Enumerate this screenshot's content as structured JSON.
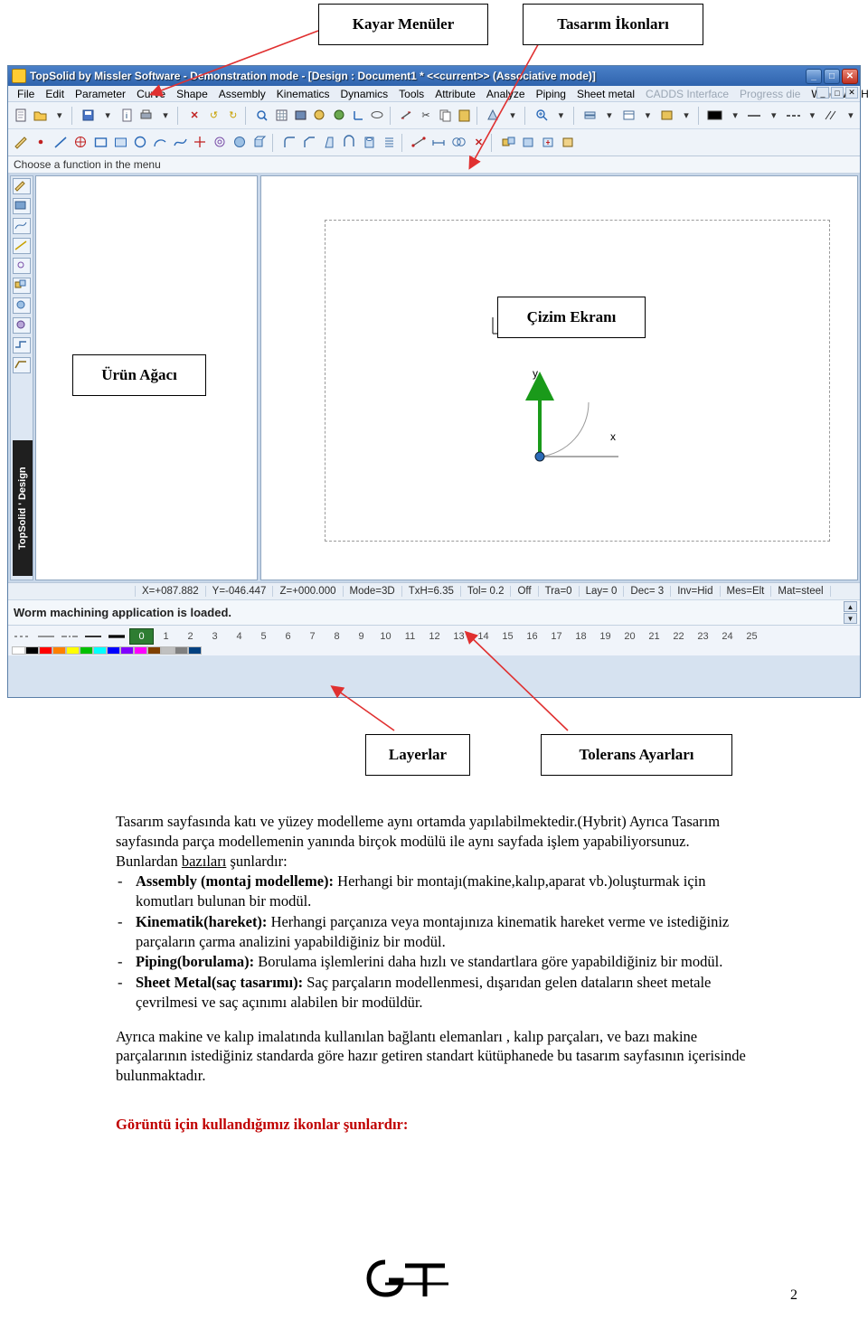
{
  "callouts": [
    {
      "id": "kayar-menuler",
      "label": "Kayar Menüler"
    },
    {
      "id": "tasarim-ikonlari",
      "label": "Tasarım İkonları"
    },
    {
      "id": "cizim-ekrani",
      "label": "Çizim Ekranı"
    },
    {
      "id": "urun-agaci",
      "label": "Ürün Ağacı"
    },
    {
      "id": "layerlar",
      "label": "Layerlar"
    },
    {
      "id": "tolerans-ayarlari",
      "label": "Tolerans  Ayarları"
    }
  ],
  "app": {
    "title": "TopSolid by Missler Software - Demonstration mode  - [Design : Document1 *  <<current>> (Associative mode)]",
    "title_icon": "topsolid-logo-icon",
    "window_buttons": [
      {
        "name": "minimize-button",
        "glyph": "_"
      },
      {
        "name": "maximize-button",
        "glyph": "□"
      },
      {
        "name": "close-button",
        "glyph": "✕"
      }
    ],
    "menu": [
      {
        "label": "File",
        "dim": false
      },
      {
        "label": "Edit",
        "dim": false
      },
      {
        "label": "Parameter",
        "dim": false
      },
      {
        "label": "Curve",
        "dim": false
      },
      {
        "label": "Shape",
        "dim": false
      },
      {
        "label": "Assembly",
        "dim": false
      },
      {
        "label": "Kinematics",
        "dim": false
      },
      {
        "label": "Dynamics",
        "dim": false
      },
      {
        "label": "Tools",
        "dim": false
      },
      {
        "label": "Attribute",
        "dim": false
      },
      {
        "label": "Analyze",
        "dim": false
      },
      {
        "label": "Piping",
        "dim": false
      },
      {
        "label": "Sheet metal",
        "dim": false
      },
      {
        "label": "CADDS Interface",
        "dim": true
      },
      {
        "label": "Progress die",
        "dim": true
      },
      {
        "label": "Window",
        "dim": false
      },
      {
        "label": "Help",
        "dim": false
      }
    ],
    "menu_window_buttons": [
      {
        "name": "mdi-minimize-button",
        "glyph": "_"
      },
      {
        "name": "mdi-restore-button",
        "glyph": "□"
      },
      {
        "name": "mdi-close-button",
        "glyph": "✕"
      }
    ],
    "prompt": "Choose a function in the menu",
    "vertical_label": "TopSolid ' Design",
    "coord_items": [
      "X=+087.882",
      "Y=-046.447",
      "Z=+000.000",
      "Mode=3D",
      "TxH=6.35",
      "Tol= 0.2",
      "Off",
      "Tra=0",
      "Lay= 0",
      "Dec= 3",
      "Inv=Hid",
      "Mes=Elt",
      "Mat=steel"
    ],
    "message": "Worm machining application is loaded.",
    "layers": [
      "0",
      "1",
      "2",
      "3",
      "4",
      "5",
      "6",
      "7",
      "8",
      "9",
      "10",
      "11",
      "12",
      "13",
      "14",
      "15",
      "16",
      "17",
      "18",
      "19",
      "20",
      "21",
      "22",
      "23",
      "24",
      "25"
    ],
    "active_layer": "0",
    "axis_labels": {
      "x": "x",
      "y": "y"
    },
    "palette": [
      "#ffffff",
      "#000000",
      "#ff0000",
      "#ff8000",
      "#ffff00",
      "#00c000",
      "#00ffff",
      "#0000ff",
      "#8000ff",
      "#ff00ff",
      "#804000",
      "#c0c0c0",
      "#808080",
      "#004080"
    ]
  },
  "body": {
    "para1": "Tasarım sayfasında katı ve yüzey modelleme aynı ortamda yapılabilmektedir.(Hybrit) Ayrıca Tasarım sayfasında parça modellemenin yanında birçok modülü ile aynı sayfada işlem yapabiliyorsunuz.",
    "para1_tail_plain": "Bunlardan ",
    "para1_underline": "bazıları",
    "para1_after": " şunlardır:",
    "bullets": [
      {
        "dash": "-",
        "bold": "Assembly (montaj modelleme):",
        "text": " Herhangi bir montajı(makine,kalıp,aparat vb.)oluşturmak için komutları bulunan bir modül."
      },
      {
        "dash": "-",
        "bold": "Kinematik(hareket):",
        "text": " Herhangi parçanıza veya montajınıza kinematik hareket verme ve istediğiniz parçaların  çarma analizini yapabildiğiniz bir modül."
      },
      {
        "dash": "-",
        "bold": "Piping(borulama):",
        "text": " Borulama işlemlerini daha hızlı ve standartlara göre yapabildiğiniz bir modül."
      },
      {
        "dash": "-",
        "bold": "Sheet Metal(saç tasarımı):",
        "text": " Saç parçaların modellenmesi, dışarıdan gelen dataların sheet metale çevrilmesi ve saç açınımı alabilen bir modüldür."
      }
    ],
    "para2": "Ayrıca makine ve kalıp imalatında kullanılan bağlantı elemanları , kalıp parçaları, ve bazı makine parçalarının istediğiniz standarda göre hazır getiren standart kütüphanede bu tasarım sayfasının içerisinde bulunmaktadır.",
    "para3_red": "Görüntü için kullandığımız ikonlar şunlardır:",
    "page_number": "2"
  }
}
